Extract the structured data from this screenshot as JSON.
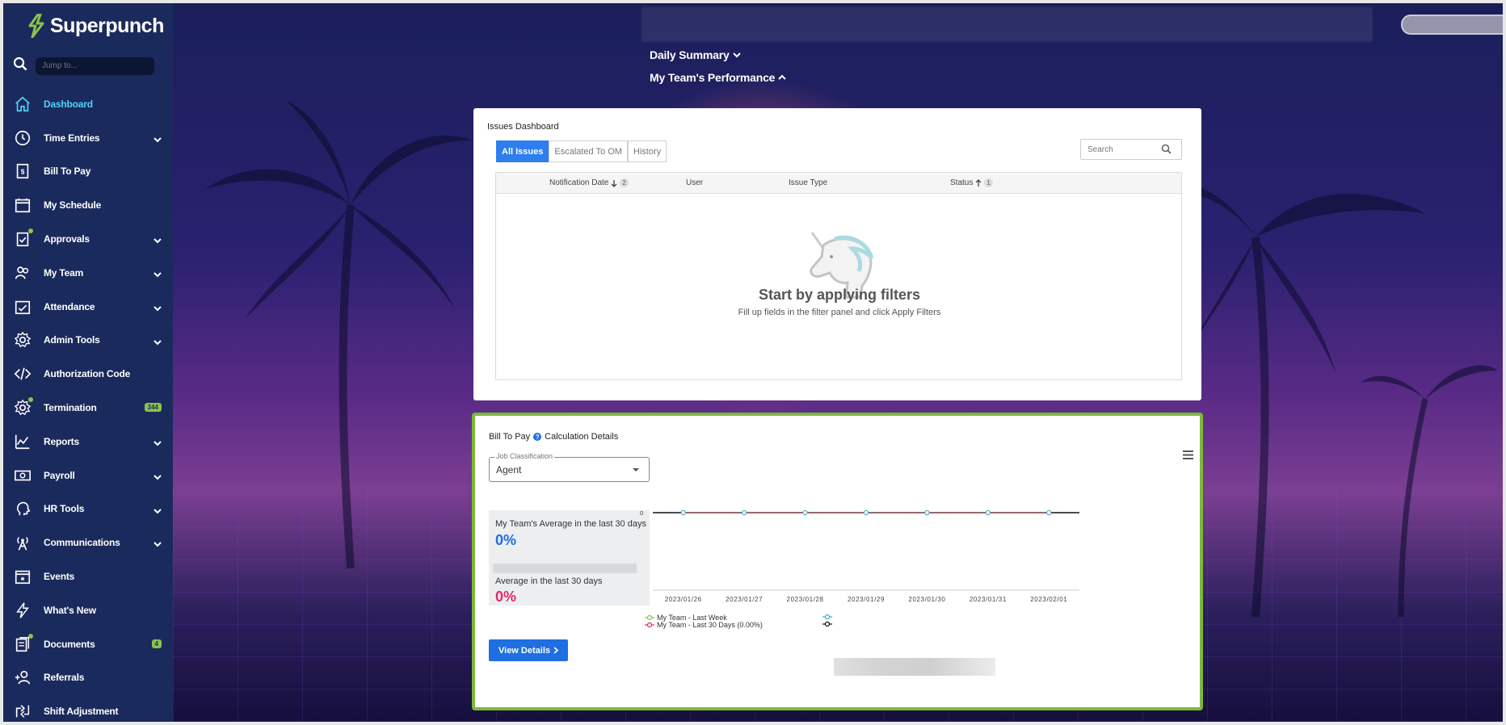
{
  "app": {
    "brand": "Superpunch",
    "brand_color": "#4ed3ff",
    "accent": "#7cb83b"
  },
  "sidebar": {
    "jump_placeholder": "Jump to...",
    "items": [
      {
        "label": "Dashboard",
        "icon": "home-icon",
        "active": true
      },
      {
        "label": "Time Entries",
        "icon": "clock-icon",
        "expandable": true
      },
      {
        "label": "Bill To Pay",
        "icon": "invoice-icon"
      },
      {
        "label": "My Schedule",
        "icon": "calendar-icon"
      },
      {
        "label": "Approvals",
        "icon": "clipboard-check-icon",
        "expandable": true,
        "dot": true
      },
      {
        "label": "My Team",
        "icon": "team-icon",
        "expandable": true
      },
      {
        "label": "Attendance",
        "icon": "attendance-icon",
        "expandable": true
      },
      {
        "label": "Admin Tools",
        "icon": "gear-icon",
        "expandable": true
      },
      {
        "label": "Authorization Code",
        "icon": "code-icon"
      },
      {
        "label": "Termination",
        "icon": "gear-icon",
        "badge": "344",
        "dot": true
      },
      {
        "label": "Reports",
        "icon": "chart-icon",
        "expandable": true
      },
      {
        "label": "Payroll",
        "icon": "money-icon",
        "expandable": true
      },
      {
        "label": "HR Tools",
        "icon": "head-icon",
        "expandable": true
      },
      {
        "label": "Communications",
        "icon": "antenna-icon",
        "expandable": true
      },
      {
        "label": "Events",
        "icon": "event-calendar-icon"
      },
      {
        "label": "What's New",
        "icon": "lightning-icon"
      },
      {
        "label": "Documents",
        "icon": "documents-icon",
        "badge": "4",
        "dot": true
      },
      {
        "label": "Referrals",
        "icon": "referral-icon"
      },
      {
        "label": "Shift Adjustment",
        "icon": "shift-icon"
      }
    ]
  },
  "sections": {
    "daily_summary": "Daily Summary",
    "team_performance": "My Team's Performance"
  },
  "issues": {
    "title": "Issues Dashboard",
    "tabs": [
      "All Issues",
      "Escalated To OM",
      "History"
    ],
    "search_placeholder": "Search",
    "columns": {
      "notification_date": "Notification Date",
      "notification_sort": "2",
      "user": "User",
      "issue_type": "Issue Type",
      "status": "Status",
      "status_sort": "1"
    },
    "empty_title": "Start by applying filters",
    "empty_subtitle": "Fill up fields in the filter panel and click Apply Filters"
  },
  "bill_to_pay": {
    "label": "Bill To Pay",
    "help": "?",
    "calc_label": "Calculation Details",
    "job_classification_label": "Job Classification",
    "job_classification_value": "Agent",
    "team_avg_caption": "My Team's Average in the last 30 days",
    "team_avg_value": "0%",
    "team_avg_color": "#1f6fe0",
    "avg_caption": "Average in the last 30 days",
    "avg_value": "0%",
    "avg_color": "#e0296b",
    "view_details": "View Details"
  },
  "chart_data": {
    "type": "line",
    "x": [
      "2023/01/26",
      "2023/01/27",
      "2023/01/28",
      "2023/01/29",
      "2023/01/30",
      "2023/01/31",
      "2023/02/01"
    ],
    "y_tick": "0",
    "series": [
      {
        "name": "My Team - Last Week",
        "values": [
          0,
          0,
          0,
          0,
          0,
          0,
          0
        ],
        "color": "#8bc34a"
      },
      {
        "name": "My Team - Last 30 Days (0.00%)",
        "values": [
          0,
          0,
          0,
          0,
          0,
          0,
          0
        ],
        "color": "#e0296b"
      }
    ]
  }
}
